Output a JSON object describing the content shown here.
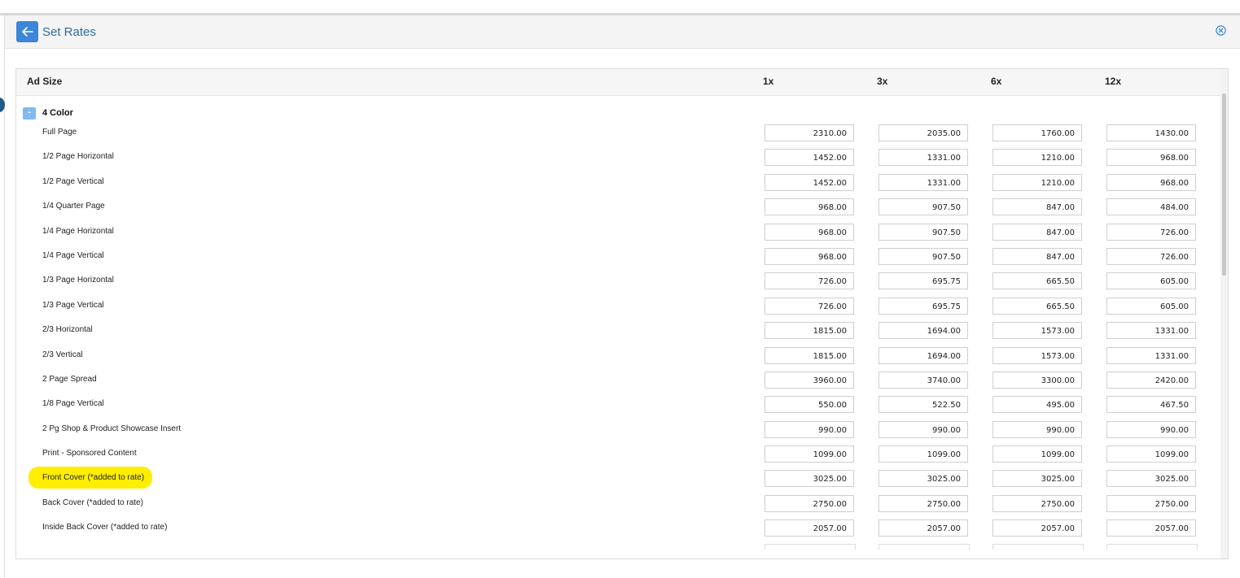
{
  "header": {
    "title": "Set Rates",
    "back_icon": "arrow-left-icon",
    "close_icon": "circle-x-icon"
  },
  "table": {
    "headers": {
      "ad_size": "Ad Size",
      "col1": "1x",
      "col3": "3x",
      "col6": "6x",
      "col12": "12x"
    },
    "group": {
      "toggle": "-",
      "name": "4 Color"
    },
    "rows": [
      {
        "label": "Full Page",
        "r1": "2310.00",
        "r3": "2035.00",
        "r6": "1760.00",
        "r12": "1430.00"
      },
      {
        "label": "1/2 Page Horizontal",
        "r1": "1452.00",
        "r3": "1331.00",
        "r6": "1210.00",
        "r12": "968.00"
      },
      {
        "label": "1/2 Page Vertical",
        "r1": "1452.00",
        "r3": "1331.00",
        "r6": "1210.00",
        "r12": "968.00"
      },
      {
        "label": "1/4 Quarter Page",
        "r1": "968.00",
        "r3": "907.50",
        "r6": "847.00",
        "r12": "484.00"
      },
      {
        "label": "1/4 Page Horizontal",
        "r1": "968.00",
        "r3": "907.50",
        "r6": "847.00",
        "r12": "726.00"
      },
      {
        "label": "1/4 Page Vertical",
        "r1": "968.00",
        "r3": "907.50",
        "r6": "847.00",
        "r12": "726.00"
      },
      {
        "label": "1/3 Page Horizontal",
        "r1": "726.00",
        "r3": "695.75",
        "r6": "665.50",
        "r12": "605.00"
      },
      {
        "label": "1/3 Page Vertical",
        "r1": "726.00",
        "r3": "695.75",
        "r6": "665.50",
        "r12": "605.00"
      },
      {
        "label": "2/3 Horizontal",
        "r1": "1815.00",
        "r3": "1694.00",
        "r6": "1573.00",
        "r12": "1331.00"
      },
      {
        "label": "2/3 Vertical",
        "r1": "1815.00",
        "r3": "1694.00",
        "r6": "1573.00",
        "r12": "1331.00"
      },
      {
        "label": "2 Page Spread",
        "r1": "3960.00",
        "r3": "3740.00",
        "r6": "3300.00",
        "r12": "2420.00"
      },
      {
        "label": "1/8 Page Vertical",
        "r1": "550.00",
        "r3": "522.50",
        "r6": "495.00",
        "r12": "467.50"
      },
      {
        "label": "2 Pg Shop & Product Showcase Insert",
        "r1": "990.00",
        "r3": "990.00",
        "r6": "990.00",
        "r12": "990.00"
      },
      {
        "label": "Print - Sponsored Content",
        "r1": "1099.00",
        "r3": "1099.00",
        "r6": "1099.00",
        "r12": "1099.00"
      },
      {
        "label": "Front Cover (*added to rate)",
        "r1": "3025.00",
        "r3": "3025.00",
        "r6": "3025.00",
        "r12": "3025.00"
      },
      {
        "label": "Back Cover (*added to rate)",
        "r1": "2750.00",
        "r3": "2750.00",
        "r6": "2750.00",
        "r12": "2750.00"
      },
      {
        "label": "Inside Back Cover (*added to rate)",
        "r1": "2057.00",
        "r3": "2057.00",
        "r6": "2057.00",
        "r12": "2057.00"
      }
    ]
  }
}
